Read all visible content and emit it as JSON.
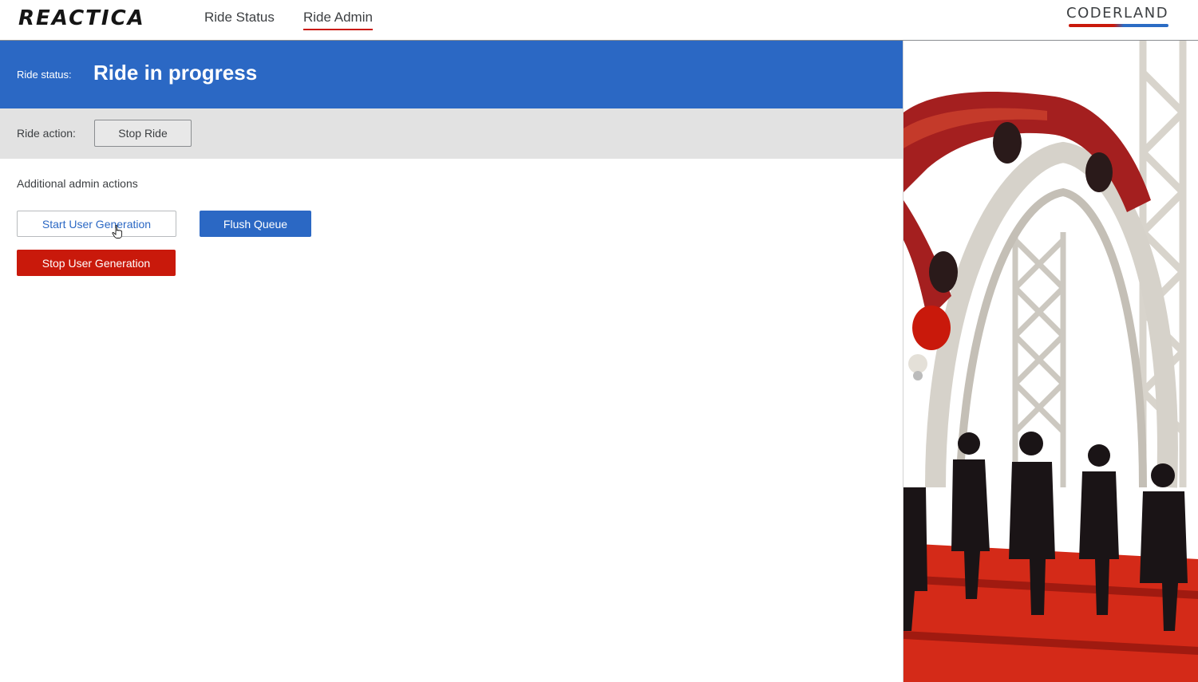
{
  "nav": {
    "brand": "REACTICA",
    "items": [
      {
        "label": "Ride Status",
        "active": false
      },
      {
        "label": "Ride Admin",
        "active": true
      }
    ],
    "logo_text": "CODERLAND"
  },
  "status": {
    "label": "Ride status:",
    "value": "Ride in progress"
  },
  "ride_action": {
    "label": "Ride action:",
    "button": "Stop Ride"
  },
  "admin": {
    "title": "Additional admin actions",
    "start_user_generation": "Start User Generation",
    "flush_queue": "Flush Queue",
    "stop_user_generation": "Stop User Generation"
  },
  "colors": {
    "primary": "#2b68c4",
    "danger": "#c9190b",
    "action_band": "#e2e2e2"
  },
  "icons": [
    "hand-pointer-cursor-icon",
    "coderland-logo"
  ]
}
